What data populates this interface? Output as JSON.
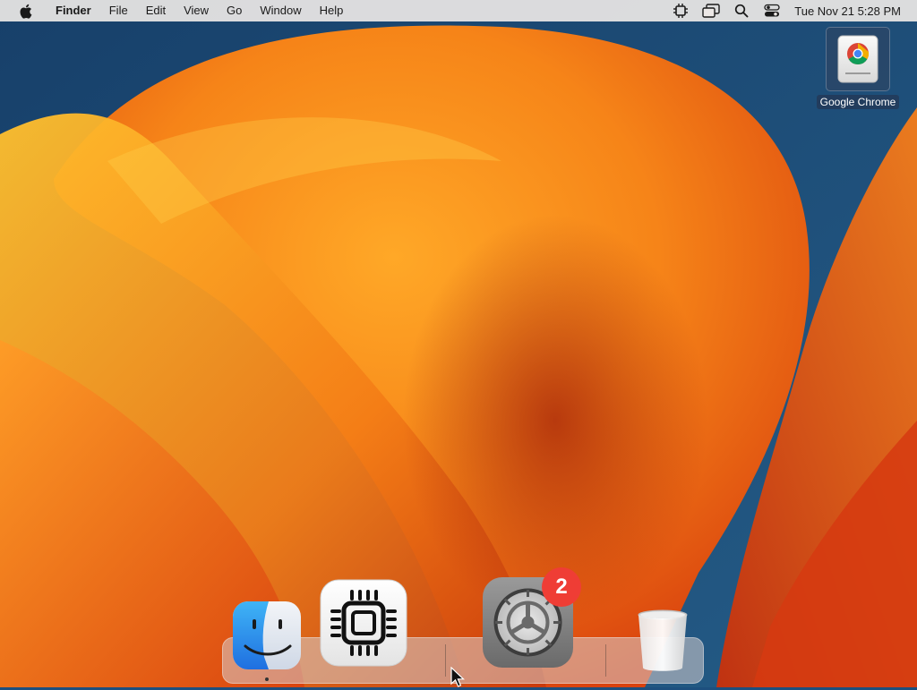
{
  "menubar": {
    "app_name": "Finder",
    "items": [
      "File",
      "Edit",
      "View",
      "Go",
      "Window",
      "Help"
    ],
    "status_icons": [
      "cpu-icon",
      "screen-mirroring-icon",
      "search-icon",
      "control-center-icon"
    ],
    "clock": "Tue Nov 21  5:28 PM"
  },
  "desktop": {
    "icons": [
      {
        "label": "Google Chrome",
        "icon": "chrome-disk-icon"
      }
    ]
  },
  "dock": {
    "apps": [
      {
        "name": "Finder",
        "icon": "finder-icon",
        "running": true
      },
      {
        "name": "CPU",
        "icon": "cpu-chip-icon",
        "running": false
      },
      {
        "name": "System Preferences",
        "icon": "system-preferences-icon",
        "badge": "2"
      },
      {
        "name": "Trash",
        "icon": "trash-icon"
      }
    ]
  },
  "colors": {
    "menubar_bg": "#ece8e6",
    "badge_red": "#ef3d35",
    "wallpaper_orange": "#f28a1c",
    "wallpaper_blue": "#1d4f7e"
  }
}
